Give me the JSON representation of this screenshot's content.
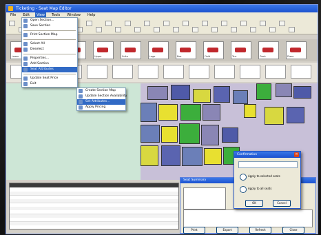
{
  "window": {
    "title": "Ticketing - Seat Map Editor"
  },
  "menubar": [
    "File",
    "Edit",
    "View",
    "Tools",
    "Window",
    "Help"
  ],
  "thumbnails": [
    "Lower",
    "Club",
    "Mezz",
    "Upper",
    "Suite",
    "Loge",
    "Box",
    "Field",
    "Terr",
    "Deck",
    "Plaza"
  ],
  "context_menu_1": {
    "items": [
      "Open Section...",
      "Save Section",
      "",
      "Print Section Map",
      "",
      "Select All",
      "Deselect",
      "",
      "Properties...",
      "Add Section",
      "Seat Attributes",
      "",
      "Update Seat Price",
      "Exit"
    ]
  },
  "context_menu_2": {
    "items": [
      "Create Section Map",
      "Update Section Availability",
      "Set Attributes...",
      "Apply Pricing"
    ]
  },
  "dialog": {
    "title": "Confirmation",
    "option1": "Apply to selected seats",
    "option2": "Apply to all seats",
    "ok": "OK",
    "cancel": "Cancel"
  },
  "panel": {
    "title": "Seat Summary"
  },
  "bottom_buttons": [
    "Print",
    "Export",
    "Refresh",
    "Close"
  ]
}
